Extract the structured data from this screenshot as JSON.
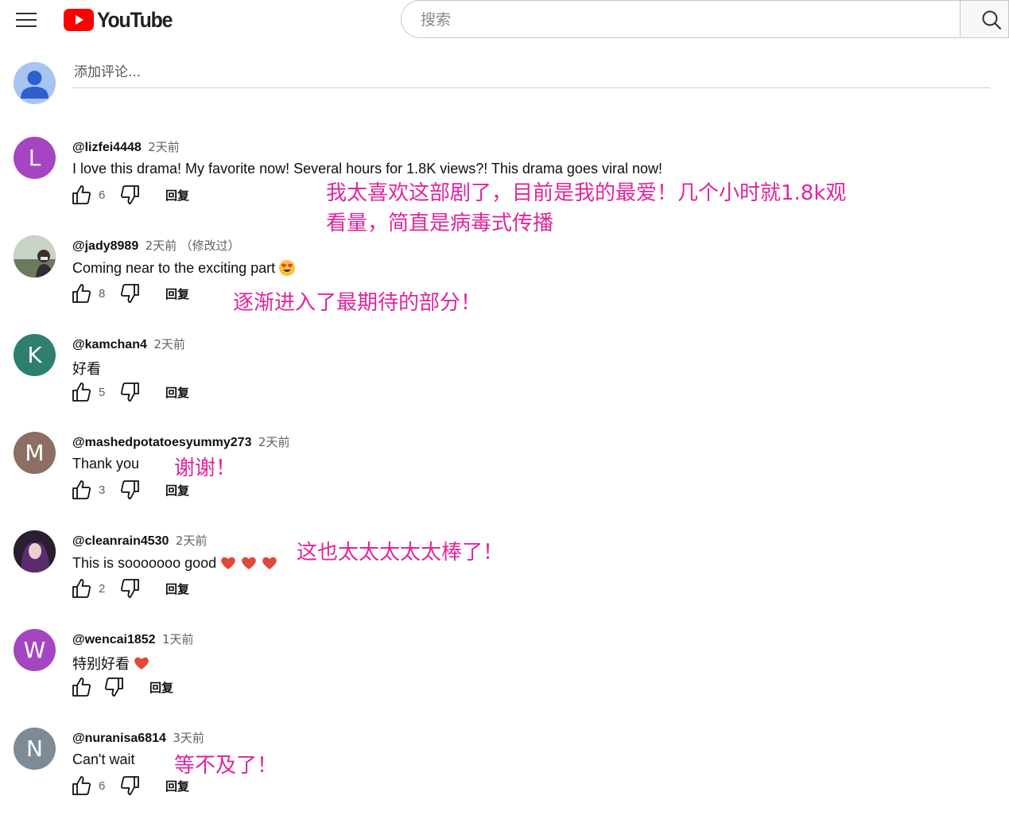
{
  "header": {
    "logo_text": "YouTube",
    "search_placeholder": "搜索"
  },
  "add_comment": {
    "placeholder": "添加评论..."
  },
  "comments": [
    {
      "initial": "L",
      "avatar_color": "#a545c2",
      "author": "@lizfei4448",
      "time": "2天前",
      "edited": "",
      "text": "I love this drama! My favorite now! Several hours for 1.8K views?! This drama goes viral now!",
      "emojis": [],
      "likes": "6",
      "reply": "回复",
      "annotation": [
        "我太喜欢这部剧了，目前是我的最爱！几个小时就1.8k观",
        "看量，简直是病毒式传播"
      ]
    },
    {
      "initial": "",
      "avatar_color": "#6e7a6a",
      "author": "@jady8989",
      "time": "2天前",
      "edited": "（修改过）",
      "text": "Coming near to the exciting part",
      "emojis": [
        "heart-eyes"
      ],
      "likes": "8",
      "reply": "回复",
      "annotation": [
        "逐渐进入了最期待的部分！"
      ]
    },
    {
      "initial": "K",
      "avatar_color": "#2e7f6e",
      "author": "@kamchan4",
      "time": "2天前",
      "edited": "",
      "text": "好看",
      "emojis": [],
      "likes": "5",
      "reply": "回复",
      "annotation": []
    },
    {
      "initial": "M",
      "avatar_color": "#8d6e63",
      "author": "@mashedpotatoesyummy273",
      "time": "2天前",
      "edited": "",
      "text": "Thank you",
      "emojis": [],
      "likes": "3",
      "reply": "回复",
      "annotation": [
        "谢谢！"
      ]
    },
    {
      "initial": "",
      "avatar_color": "#3b2a3d",
      "author": "@cleanrain4530",
      "time": "2天前",
      "edited": "",
      "text": "This is sooooooo good",
      "emojis": [
        "heart",
        "heart",
        "heart"
      ],
      "likes": "2",
      "reply": "回复",
      "annotation": [
        "这也太太太太太棒了！"
      ]
    },
    {
      "initial": "W",
      "avatar_color": "#a545c2",
      "author": "@wencai1852",
      "time": "1天前",
      "edited": "",
      "text": "特别好看",
      "emojis": [
        "heart"
      ],
      "likes": "",
      "reply": "回复",
      "annotation": []
    },
    {
      "initial": "N",
      "avatar_color": "#7d8b96",
      "author": "@nuranisa6814",
      "time": "3天前",
      "edited": "",
      "text": "Can't wait",
      "emojis": [],
      "likes": "6",
      "reply": "回复",
      "annotation": [
        "等不及了！"
      ]
    }
  ]
}
